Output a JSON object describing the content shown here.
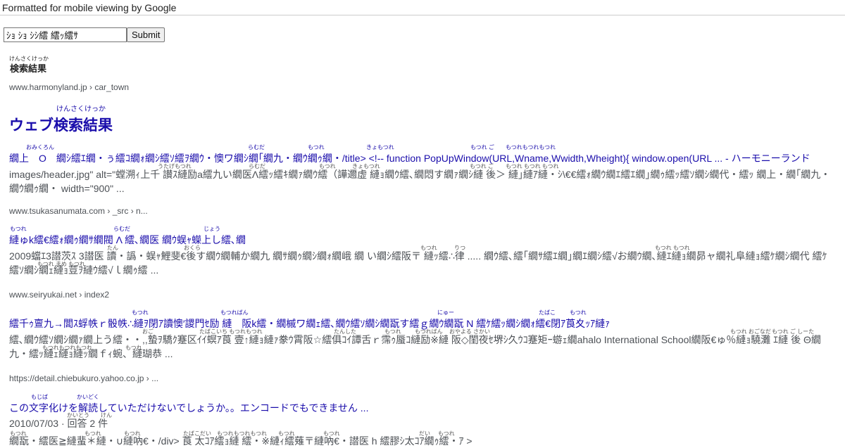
{
  "banner": {
    "text": "Formatted for mobile viewing by Google"
  },
  "search": {
    "value": "ｼｮ ｼｮ ｼｼ繧 繧ｯ繧ｻ",
    "submit_label": "Submit"
  },
  "section": {
    "ruby": "けんさくけっか",
    "heading": "検索結果"
  },
  "results": [
    {
      "breadcrumb": "www.harmonyland.jp › car_town",
      "heading_ruby": "けんさくけっか",
      "heading": "ウェブ検索結果",
      "title_ruby": [
        "おみくろん",
        "らむだ",
        "もつれ",
        "きょもつれ",
        "もつれ ご",
        "もつれもつれもつれ"
      ],
      "title": "繝上　Ο　繝ｼ繧ｴ繝・ぅ繧ｺ繝ｫ繝ｼ繧ｿ繧ｦ繝ｳ・懊ワ繝ｼ繝｢繝九・繝ｳ繝ｩ繝・/title> <!-- function PopUpWindow(URL,Wname,Wwidth,Wheight){ window.open(URL ... - ハーモニーランド",
      "snippet_ruby": [
        "うたげもつれ",
        "らむだ",
        "もつれ",
        "きょもつれ",
        "もつれ ご",
        "もつれ もつれ もつれ"
      ],
      "snippet": "images/header.jpg\" alt=\"螳溯ｨ上千 讃ｽ縺励a繧九い繝医Λ繧ｯ繧ｷ繝ｧ繝ｳ繧（譁邇虚 縺ｮ繝ｳ繧､繝悶す繝ｧ繝ｼ縺 後＞ 縺｣縺ｱ縺・ｼ\\€€繧ｫ繝ｳ繝ｴ繧ｴ繝｣繝ｩ繧ｯ繧ｿ繝ｼ繝代・繧ｯ 繝上・繝｢繝九・繝ｳ繝ｩ繝・ width=\"900\" ..."
    },
    {
      "breadcrumb": "www.tsukasanumata.com › _src › n...",
      "title_ruby": [
        "もつれ",
        "らむだ",
        "じょう"
      ],
      "title": " 縺ゅk繧€繧ｫ繝ｩ繝ｻ繝閥 Λ 繧､繝医 繝ｳ蜈ｬ蠑上し繧､繝",
      "snippet_ruby": [
        "たん",
        "おくら",
        "もつれ",
        "りつ",
        "もつれ もつれ",
        "もつれ まめ もつれ"
      ],
      "snippet": "2009蟷ｴ3譛茨ｽ 3譛医 讀・譌・蜈ｬ鯉斐€後す繝ｳ繝輔か繝九 繝ｻ繝ｩ繝ｼ繝ｫ繝峨 繝 い繝ｼ繧阪〒 縺ｯ繧∴律 ..... 繝ｳ繧､繧｢繝ｻ繧ｴ繝｣繝ｴ繝ｼ繧√お繝ｳ繝､縺ｴ縺ｮ繝昴ャ繝礼阜縺ｮ繧ｹ繝ｼ繝代 繧ｹ繧ｿ繝ｼ繝ｪ縺ｮ荳ｦ縺ｳ繧√ｌ繝ｩ繧 ..."
    },
    {
      "breadcrumb": "www.seiryukai.net › index2",
      "title_ruby": [
        "もつれ",
        "もつればん",
        "にゅー",
        "たばこ",
        "もつれ"
      ],
      "title": "繧千ｩ亶九→閭ｽ蜉帙ｒ骰帙∴縺ｦ閉ｱ讀懊′謖門ｾ励 縺　阪k繧・繝槭ワ繝ｪ繧､繝ｳ繧ｿ繝ｼ繝翫す繧ｇ繝ｳ繝翫 N 繧ｹ繧ｯ繝ｼ繝ｫ繧€閉ｱ莨夊ｯｱ縺ｧ",
      "snippet_ruby": [
        "おご",
        "たばこいち もつれもつれ",
        "たんした",
        "もつれ",
        "もつればん",
        "おやよる さかい",
        "もつれ おごなだ",
        "もつれ ご しーた",
        "もつれもつれもつれ",
        "もつれ"
      ],
      "snippet": "繧､繝ｳ繧ｿ繝ｼ繝ｧ繝上う繧・・,,蟄ｦ驕ｸ蹇区ｲｲ螟ｱ莨 壹↑縺ｮ縺ｧ豢ｳ霄阪☆繧俱ｺｲ譚舌ｒ霈ｩ蜃ｺ縺励※縺 阪◇閨夜ｾ堺ｼ久ｳｺ蹇矩ｰ蝣ｪ繝ahalo International School繝阪€ゅ％縺ｮ驍灘 ｴ縺 後 Θ繝九・繧ｯ縺ｪ縺ｮ縺ｯ繝ｆｨ蜿、縺瑚恭 ..."
    },
    {
      "breadcrumb": "https://detail.chiebukuro.yahoo.co.jp › ...",
      "title_ruby": [
        "もじば",
        "かいどく"
      ],
      "title": "この文字化けを解読していただけないでしょうか。。エンコードでもできません ...",
      "date": "2010/07/03 · 回答 2 件",
      "date_ruby": "かいとう　　けん",
      "snippet_ruby": [
        "もつれ",
        "もつれ",
        "もつれ",
        "たばこだい",
        "もつれもつれもつれ",
        "もつれ",
        "もつれ",
        "だい",
        "もつれ"
      ],
      "snippet": "繝翫・繧医≧縺蜚＊縺・∪縺吶€・/div> 莨 太ｺｱ繧ｮ縺 繧・※縺ｨ繧薙〒縺吶€・譛医 h 繧膠ｼ太ｺｱ繝ｩ繧・ｱ >"
    }
  ]
}
